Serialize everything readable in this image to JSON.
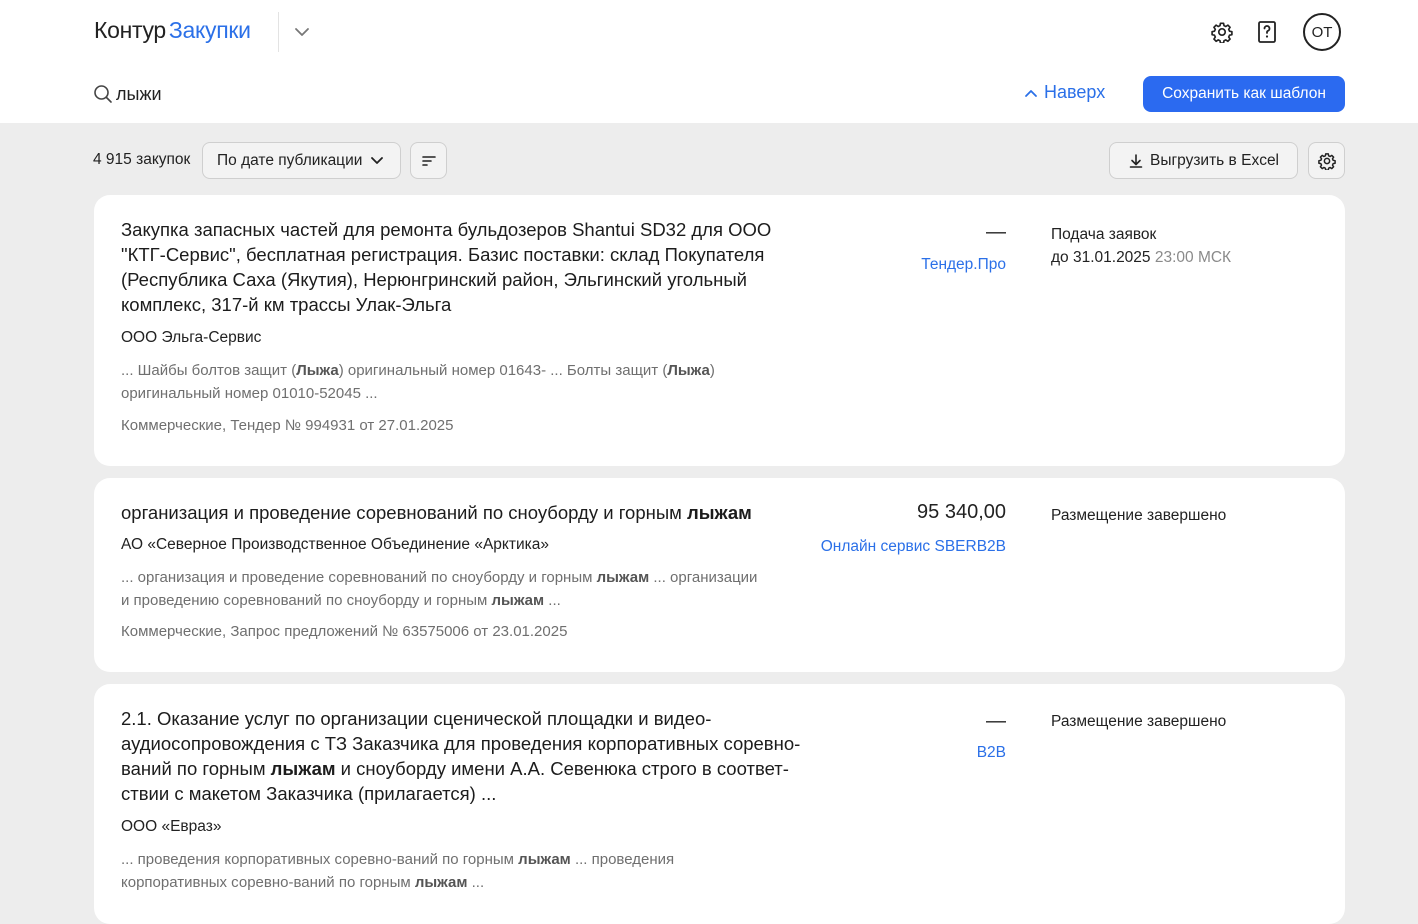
{
  "header": {
    "logo_brand": "Контур",
    "logo_product": "Закупки",
    "avatar_initials": "ОТ"
  },
  "search": {
    "value": "лыжи",
    "up_label": "Наверх",
    "save_template_label": "Сохранить как шаблон"
  },
  "toolbar": {
    "count": "4 915 закупок",
    "sort_value": "По дате публикации",
    "export_label": "Выгрузить в Excel"
  },
  "colors": {
    "accent": "#2b70e8",
    "button_primary": "#2b6af0",
    "page_background": "#ededed"
  },
  "cards": [
    {
      "title_parts": [
        {
          "text": "Закупка запасных частей для ремонта бульдозеров Shantui SD32 для ООО \"КТГ-Сервис\", бесплатная регистрация. Базис поставки: склад Покупателя (Республика Саха (Якутия), Нерюнгринский район, Эльгинский угольный комплекс, 317-й км трассы Улак-Эльга",
          "bold": false
        }
      ],
      "customer": "ООО Эльга-Сервис",
      "snippet_parts": [
        {
          "text": "... Шайбы болтов защит (",
          "bold": false
        },
        {
          "text": "Лыжа",
          "bold": true
        },
        {
          "text": ") оригинальный номер 01643- ... Болты защит (",
          "bold": false
        },
        {
          "text": "Лыжа",
          "bold": true
        },
        {
          "text": ") оригинальный номер 01010-52045 ...",
          "bold": false
        }
      ],
      "meta": "Коммерческие, Тендер № 994931 от 27.01.2025",
      "price": "—",
      "platform": "Тендер.Про",
      "status_line1": "Подача заявок",
      "status_line2": "до 31.01.2025",
      "status_time": "23:00 МСК"
    },
    {
      "title_parts": [
        {
          "text": "организация и проведение соревнований по сноуборду и горным ",
          "bold": false
        },
        {
          "text": "лыжам",
          "bold": true
        }
      ],
      "customer": "АО «Северное Производственное Объединение «Арктика»",
      "snippet_parts": [
        {
          "text": "... организация и проведение соревнований по сноуборду и горным ",
          "bold": false
        },
        {
          "text": "лыжам",
          "bold": true
        },
        {
          "text": " ... организации и проведению соревнований по сноуборду и горным ",
          "bold": false
        },
        {
          "text": "лыжам",
          "bold": true
        },
        {
          "text": " ...",
          "bold": false
        }
      ],
      "meta": "Коммерческие, Запрос предложений № 63575006 от 23.01.2025",
      "price": "95 340,00",
      "platform": "Онлайн сервис SBERB2B",
      "status_line1": "Размещение завершено"
    },
    {
      "title_parts": [
        {
          "text": "2.1. Оказание услуг по организации сценической площадки и видео-аудиосопровождения с ТЗ Заказчика для проведения корпоративных соревно-ваний по горным ",
          "bold": false
        },
        {
          "text": "лыжам",
          "bold": true
        },
        {
          "text": " и сноуборду имени А.А. Севенюка строго в соответ-ствии с макетом Заказчика (прилагается) ...",
          "bold": false
        }
      ],
      "customer": "ООО «Евраз»",
      "snippet_parts": [
        {
          "text": "... проведения корпоративных соревно-ваний по горным ",
          "bold": false
        },
        {
          "text": "лыжам",
          "bold": true
        },
        {
          "text": " ... проведения корпоративных соревно-ваний по горным ",
          "bold": false
        },
        {
          "text": "лыжам",
          "bold": true
        },
        {
          "text": " ...",
          "bold": false
        }
      ],
      "price": "—",
      "platform": "B2B",
      "status_line1": "Размещение завершено"
    }
  ]
}
